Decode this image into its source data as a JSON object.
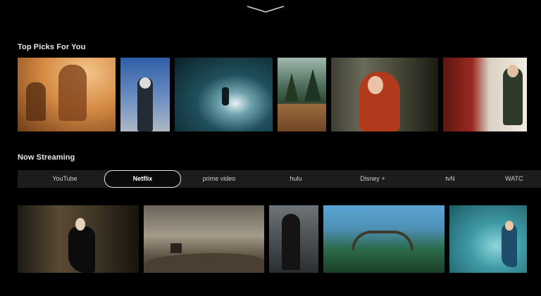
{
  "top_picks": {
    "title": "Top Picks For You"
  },
  "now_streaming": {
    "title": "Now Streaming",
    "tabs": [
      {
        "label": "YouTube",
        "active": false
      },
      {
        "label": "Netflix",
        "active": true
      },
      {
        "label": "prime video",
        "active": false
      },
      {
        "label": "hulu",
        "active": false
      },
      {
        "label": "Disney +",
        "active": false
      },
      {
        "label": "tvN",
        "active": false
      },
      {
        "label": "WATC",
        "active": false
      }
    ]
  },
  "icons": {
    "top": "chevron-down-icon"
  },
  "colors": {
    "background": "#000000",
    "tab_bar": "#1c1c1c",
    "active_tab_border": "#e6e6e6"
  }
}
